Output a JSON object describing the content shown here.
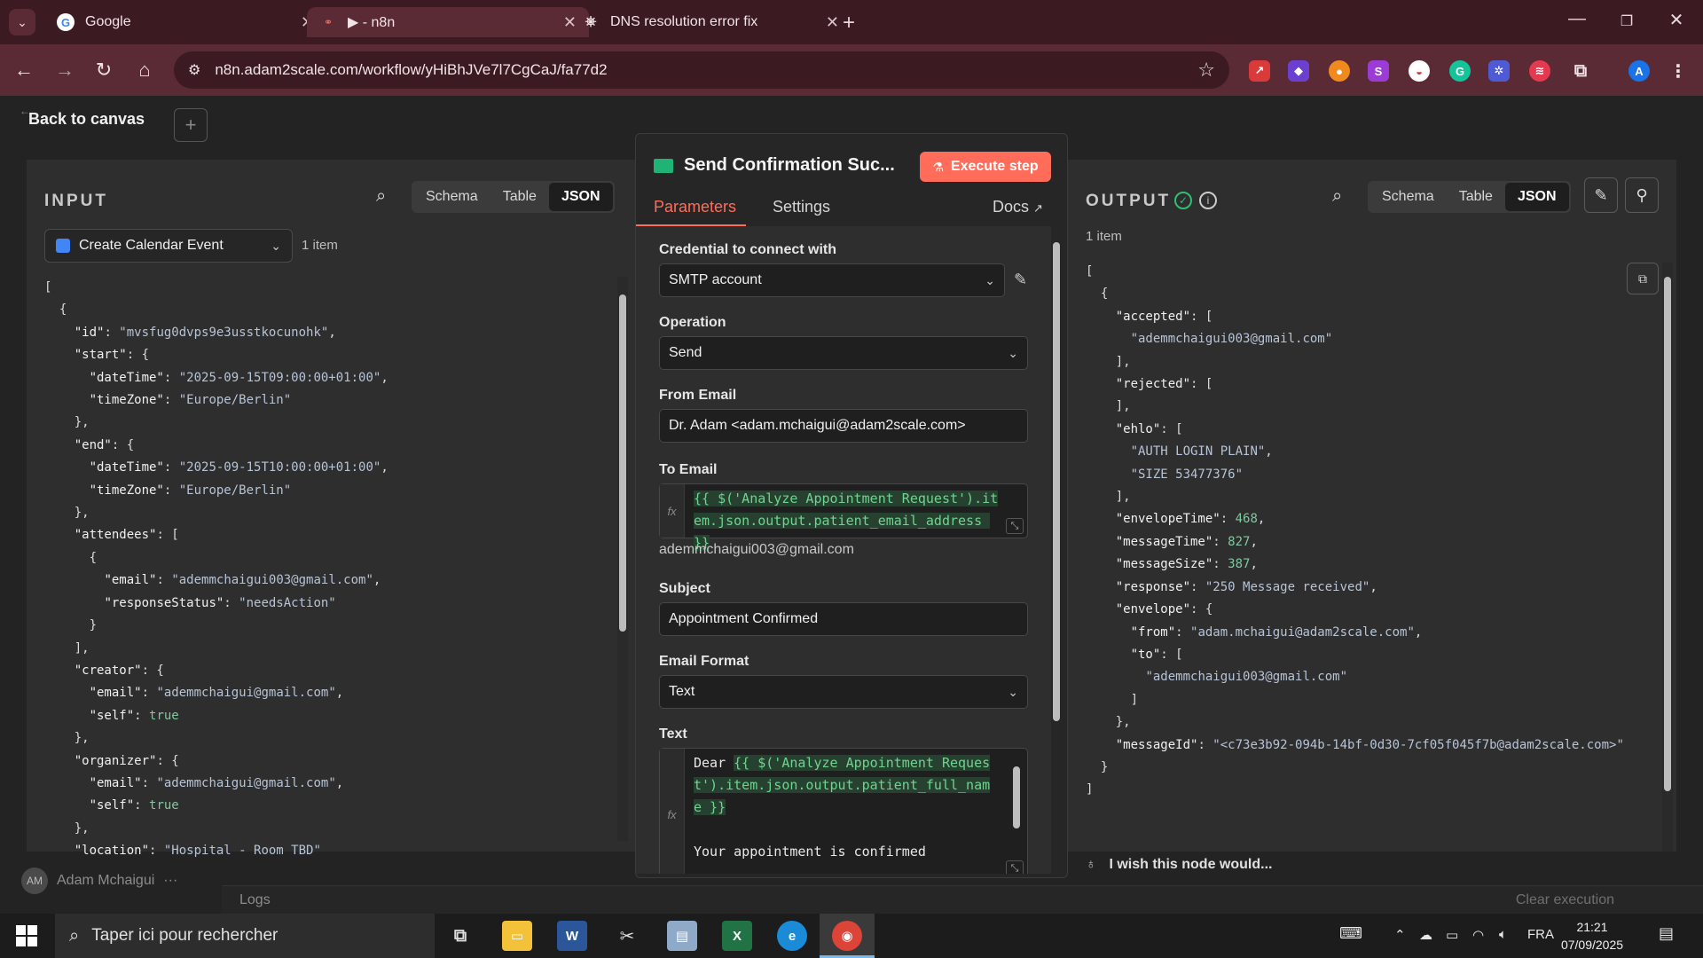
{
  "browser": {
    "tabs": [
      {
        "title": "Google",
        "favicon": "google-icon"
      },
      {
        "title": "▶ - n8n",
        "favicon": "n8n-icon"
      },
      {
        "title": "DNS resolution error fix",
        "favicon": "chatgpt-icon"
      }
    ],
    "url": "n8n.adam2scale.com/workflow/yHiBhJVe7l7CgCaJ/fa77d2"
  },
  "app": {
    "back_label": "Back to canvas",
    "logo_text": "n8n"
  },
  "input": {
    "title": "INPUT",
    "views": [
      "Schema",
      "Table",
      "JSON"
    ],
    "node_select": "Create Calendar Event",
    "count": "1 item"
  },
  "node": {
    "title": "Send Confirmation Suc...",
    "execute_label": "Execute step",
    "tabs": {
      "parameters": "Parameters",
      "settings": "Settings",
      "docs": "Docs"
    },
    "credential_label": "Credential to connect with",
    "credential_value": "SMTP account",
    "operation_label": "Operation",
    "operation_value": "Send",
    "from_label": "From Email",
    "from_value": "Dr. Adam <adam.mchaigui@adam2scale.com>",
    "to_label": "To Email",
    "to_expr": "{{ $('Analyze Appointment Request').item.json.output.patient_email_address }}",
    "to_resolved": "ademmchaigui003@gmail.com",
    "subject_label": "Subject",
    "subject_value": "Appointment Confirmed",
    "format_label": "Email Format",
    "format_value": "Text",
    "text_label": "Text",
    "text_prefix": "Dear ",
    "text_expr": "{{ $('Analyze Appointment Request').item.json.output.patient_full_name }}",
    "text_body": "Your appointment is confirmed"
  },
  "output": {
    "title": "OUTPUT",
    "views": [
      "Schema",
      "Table",
      "JSON"
    ],
    "count": "1 item",
    "feedback": "I wish this node would..."
  },
  "footer": {
    "user": "Adam Mchaigui",
    "user_initials": "AM",
    "logs": "Logs",
    "clear": "Clear execution"
  },
  "taskbar": {
    "search_placeholder": "Taper ici pour rechercher",
    "lang": "FRA",
    "time": "21:21",
    "date": "07/09/2025"
  }
}
